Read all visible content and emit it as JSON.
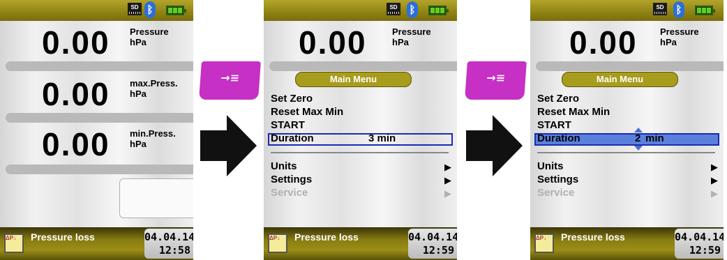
{
  "status": {
    "sd_label": "SD",
    "bluetooth_symbol": "ᛒ",
    "battery_bars": 3
  },
  "screen1": {
    "rows": [
      {
        "value": "0.00",
        "label1": "Pressure",
        "label2": "hPa"
      },
      {
        "value": "0.00",
        "label1": "max.Press.",
        "label2": "hPa"
      },
      {
        "value": "0.00",
        "label1": "min.Press.",
        "label2": "hPa"
      }
    ],
    "footer": {
      "title": "Pressure loss",
      "date": "04.04.14",
      "time": "12:58",
      "icon_text": "ΔP↓"
    }
  },
  "screen2": {
    "top": {
      "value": "0.00",
      "label1": "Pressure",
      "label2": "hPa"
    },
    "menu_title": "Main Menu",
    "items": {
      "set_zero": "Set Zero",
      "reset": "Reset Max Min",
      "start": "START",
      "duration": "Duration",
      "duration_value": "3 min",
      "units": "Units",
      "settings": "Settings",
      "service": "Service"
    },
    "footer": {
      "title": "Pressure loss",
      "date": "04.04.14",
      "time": "12:59",
      "icon_text": "ΔP↓"
    }
  },
  "screen3": {
    "top": {
      "value": "0.00",
      "label1": "Pressure",
      "label2": "hPa"
    },
    "menu_title": "Main Menu",
    "items": {
      "set_zero": "Set Zero",
      "reset": "Reset Max Min",
      "start": "START",
      "duration": "Duration",
      "duration_number": "2",
      "duration_unit": "min",
      "units": "Units",
      "settings": "Settings",
      "service": "Service"
    },
    "footer": {
      "title": "Pressure loss",
      "date": "04.04.14",
      "time": "12:59",
      "icon_text": "ΔP↓"
    }
  },
  "key_button": {
    "symbol": "→≡",
    "color": "#c630c4"
  },
  "submenu_arrow": "▶",
  "colors": {
    "accent": "#8f8213",
    "highlight_border": "#1b2bb0",
    "highlight_fill": "#5a80dc"
  }
}
